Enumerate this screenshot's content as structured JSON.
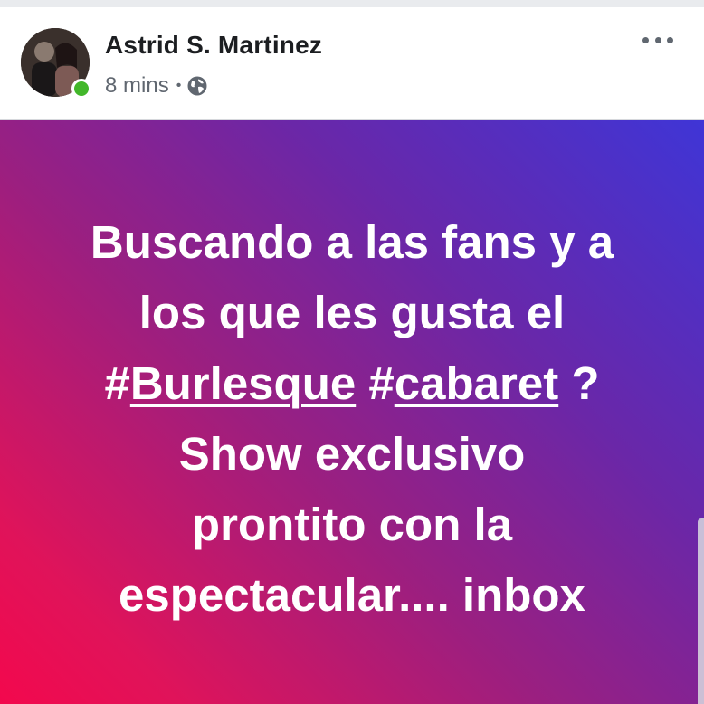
{
  "post": {
    "author_name": "Astrid S. Martinez",
    "timestamp": "8 mins",
    "separator": "•",
    "privacy_icon": "globe-icon",
    "menu_icon": "more-options-icon",
    "online_status_color": "#42b72a",
    "text": {
      "line1": "Buscando a las fans y a",
      "line2": "los que les gusta el",
      "hash_prefix_1": "#",
      "hashtag_1": "Burlesque",
      "hash_prefix_2": " #",
      "hashtag_2": "cabaret",
      "line3_tail": " ?",
      "line4": "Show exclusivo",
      "line5": "prontito con la",
      "line6": "espectacular.... inbox"
    },
    "background_gradient": [
      "#3f35d6",
      "#6a27a8",
      "#9b1f80",
      "#e0135a",
      "#f3084d"
    ]
  }
}
